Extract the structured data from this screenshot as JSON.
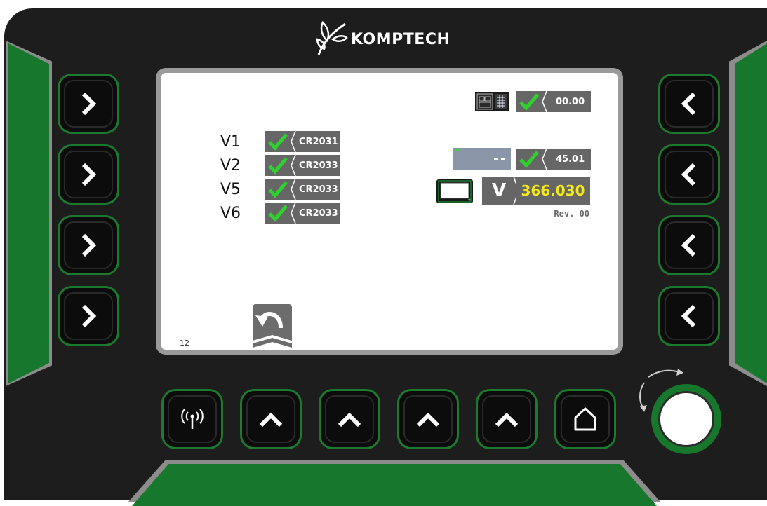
{
  "brand": {
    "name": "KOMPTECH"
  },
  "left_buttons": [
    {
      "icon": "chevron-right-icon"
    },
    {
      "icon": "chevron-right-icon"
    },
    {
      "icon": "chevron-right-icon"
    },
    {
      "icon": "chevron-right-icon"
    }
  ],
  "right_buttons": [
    {
      "icon": "chevron-left-icon"
    },
    {
      "icon": "chevron-left-icon"
    },
    {
      "icon": "chevron-left-icon"
    },
    {
      "icon": "chevron-left-icon"
    }
  ],
  "bottom_buttons": [
    {
      "icon": "antenna-icon"
    },
    {
      "icon": "chevron-up-icon"
    },
    {
      "icon": "chevron-up-icon"
    },
    {
      "icon": "chevron-up-icon"
    },
    {
      "icon": "chevron-up-icon"
    },
    {
      "icon": "home-icon"
    }
  ],
  "screen": {
    "valves": [
      {
        "label": "V1",
        "code": "CR2031"
      },
      {
        "label": "V2",
        "code": "CR2033"
      },
      {
        "label": "V5",
        "code": "CR2033"
      },
      {
        "label": "V6",
        "code": "CR2033"
      }
    ],
    "status_top": {
      "value": "00.00"
    },
    "status_mid": {
      "value": "45.01"
    },
    "version": {
      "letter": "V",
      "value": "366.030",
      "rev": "Rev. 00"
    },
    "page_number": "12"
  },
  "colors": {
    "accent_green": "#17772c",
    "check_green": "#2fd12f",
    "version_yellow": "#f4e81a",
    "badge_gray": "#666666"
  }
}
